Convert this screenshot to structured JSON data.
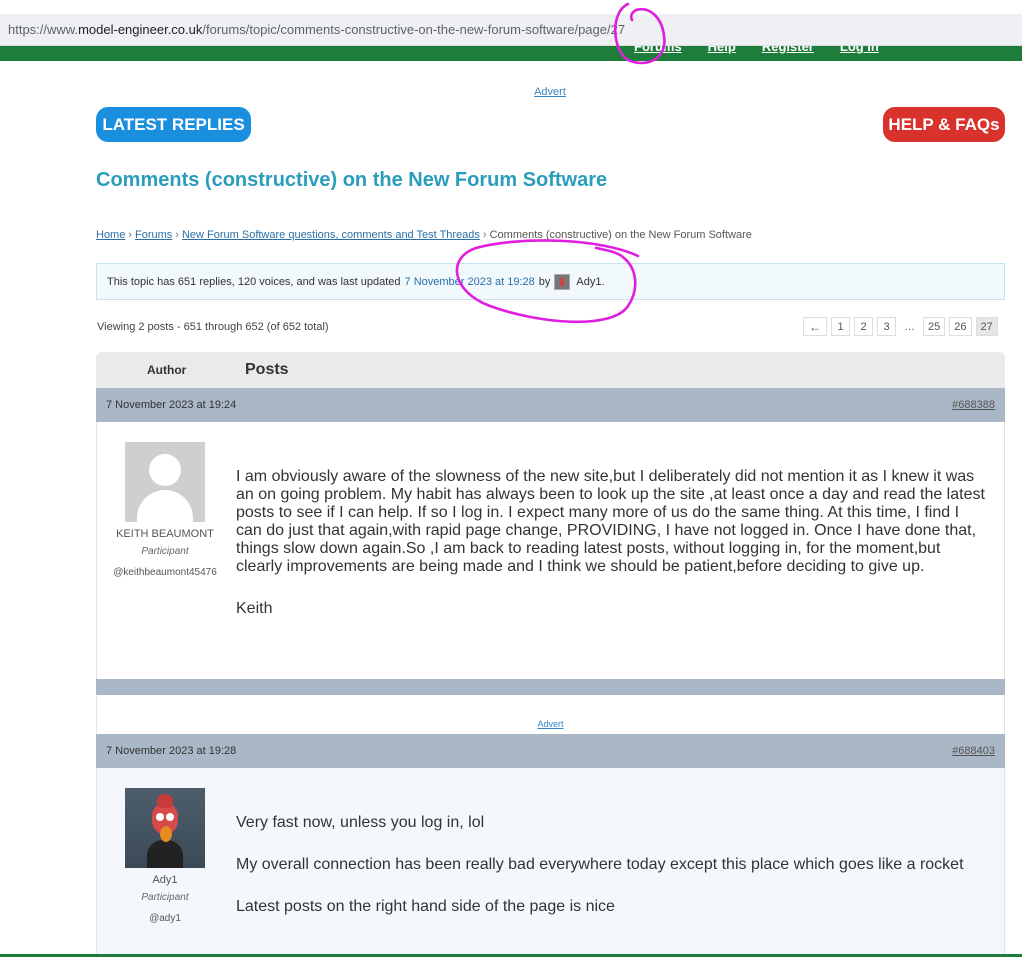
{
  "browser": {
    "url_prefix": "https://www.",
    "url_host": "model-engineer.co.uk",
    "url_path": "/forums/topic/comments-constructive-on-the-new-forum-software/page/27"
  },
  "top_nav_peek": [
    "Forums",
    "Help",
    "Register",
    "Log In"
  ],
  "advert_label": "Advert",
  "buttons": {
    "latest_replies": "LATEST REPLIES",
    "help_faqs": "HELP & FAQs"
  },
  "topic_title": "Comments (constructive) on the New Forum Software",
  "breadcrumb": {
    "home": "Home",
    "forums": "Forums",
    "category": "New Forum Software questions, comments and Test Threads",
    "current": "Comments (constructive) on the New Forum Software",
    "separator": "›"
  },
  "topic_info": {
    "prefix": "This topic has 651 replies, 120 voices, and was last updated",
    "updated": "7 November 2023 at 19:28",
    "by": "by",
    "user": "Ady1."
  },
  "viewing": "Viewing 2 posts - 651 through 652 (of 652 total)",
  "pagination": {
    "prev": "←",
    "pages": [
      "1",
      "2",
      "3",
      "…",
      "25",
      "26",
      "27"
    ],
    "current": "27"
  },
  "table_header": {
    "author": "Author",
    "posts": "Posts"
  },
  "posts": [
    {
      "date": "7 November 2023 at 19:24",
      "id": "#688388",
      "author_name": "KEITH BEAUMONT",
      "role": "Participant",
      "handle": "@keithbeaumont45476",
      "paragraphs": [
        "I am obviously aware of the slowness of the new site,but I deliberately did not mention it as I knew it was  an on going problem. My habit has always been to look up the site ,at least once a day and read the latest posts to see if I can help. If so I log in. I expect many more of us do the same thing.  At this time, I find I can do just that again,with rapid page change, PROVIDING, I have not logged in. Once I have done that, things slow down again.So ,I am back to reading latest posts, without logging in, for the moment,but clearly improvements are being made and I think we should be patient,before deciding to give up.",
        "Keith"
      ]
    },
    {
      "date": "7 November 2023 at 19:28",
      "id": "#688403",
      "author_name": "Ady1",
      "role": "Participant",
      "handle": "@ady1",
      "paragraphs": [
        "Very fast now, unless you log in, lol",
        "My overall connection has been really bad everywhere today except this place which goes like a rocket",
        "Latest posts on the right hand side of the page is nice"
      ]
    }
  ],
  "colors": {
    "forum_green": "#1e7d3b",
    "title_teal": "#2a9dbc",
    "latest_blue": "#1a8fde",
    "help_red": "#d9322d",
    "post_header": "#a9b7c6",
    "annotation_magenta": "#e01ee0"
  }
}
